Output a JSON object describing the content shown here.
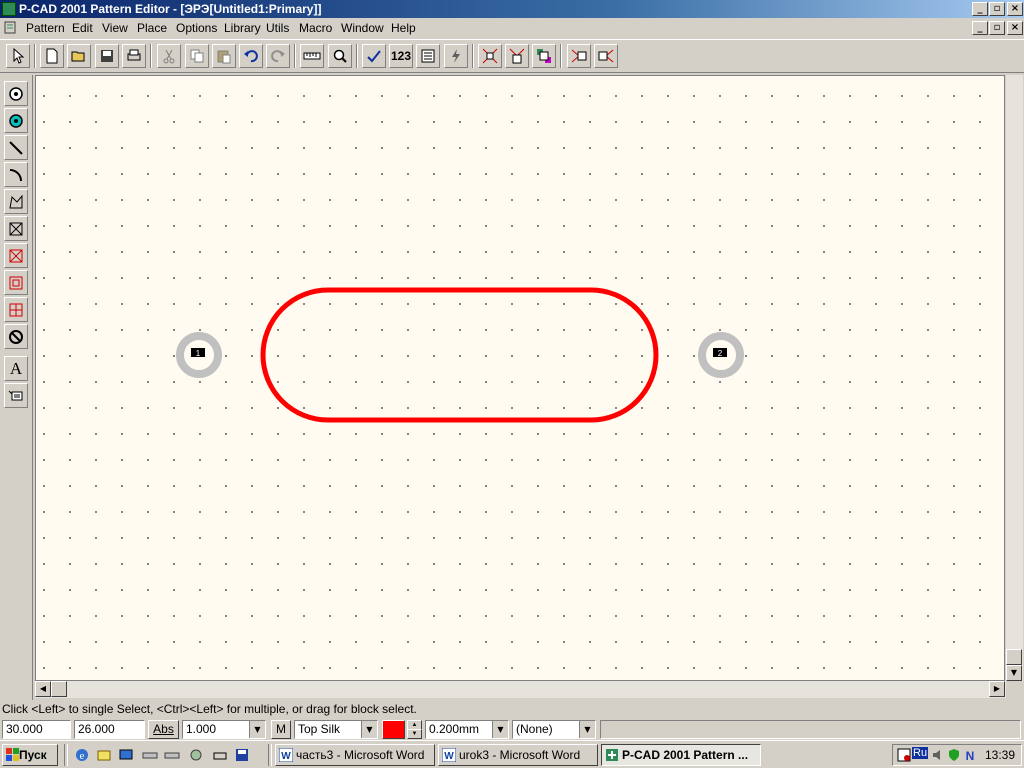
{
  "window": {
    "title": "P-CAD 2001 Pattern Editor - [ЭРЭ[Untitled1:Primary]]",
    "title_buttons": [
      "_",
      "▫",
      "×"
    ]
  },
  "menu": {
    "items": [
      "Pattern",
      "Edit",
      "View",
      "Place",
      "Options",
      "Library",
      "Utils",
      "Macro",
      "Window",
      "Help"
    ]
  },
  "toolbar": {
    "counter_label": "123",
    "icons": [
      "select-arrow-icon",
      "new-file-icon",
      "open-folder-icon",
      "save-icon",
      "print-icon",
      "cut-icon",
      "copy-icon",
      "paste-icon",
      "undo-icon",
      "redo-icon",
      "ruler-icon",
      "zoom-icon",
      "check-icon",
      "renumber-icon",
      "pad-style-icon",
      "lightning-icon",
      "dimension-1-icon",
      "dimension-2-icon",
      "dimension-3-icon",
      "mirror-1-icon",
      "mirror-2-icon"
    ]
  },
  "left_toolbar": {
    "icons": [
      "place-pad-icon",
      "place-via-icon",
      "place-line-icon",
      "place-arc-icon",
      "place-polygon-icon",
      "place-point-icon",
      "place-copper-icon",
      "place-keepout-icon",
      "place-cutout-icon",
      "no-entry-icon",
      "place-text-icon",
      "place-attribute-icon"
    ]
  },
  "canvas": {
    "pads": [
      {
        "number": "1"
      },
      {
        "number": "2"
      }
    ],
    "outline_color": "#ff0000",
    "pad_color": "#c0c0c0"
  },
  "status": {
    "message": "Click <Left> to single Select, <Ctrl><Left> for multiple, or drag for block select."
  },
  "controls": {
    "x_coord": "30.000",
    "y_coord": "26.000",
    "abs_label": "Abs",
    "grid": "1.000",
    "m_label": "M",
    "layer": "Top Silk",
    "layer_color": "#ff0000",
    "line_width": "0.200mm",
    "style": "(None)"
  },
  "taskbar": {
    "start_label": "Пуск",
    "tasks": [
      {
        "label": "часть3 - Microsoft Word",
        "active": false
      },
      {
        "label": "urok3 - Microsoft Word",
        "active": false
      },
      {
        "label": "P-CAD 2001 Pattern ...",
        "active": true
      }
    ],
    "tray": {
      "lang": "Ru",
      "time": "13:39"
    }
  }
}
